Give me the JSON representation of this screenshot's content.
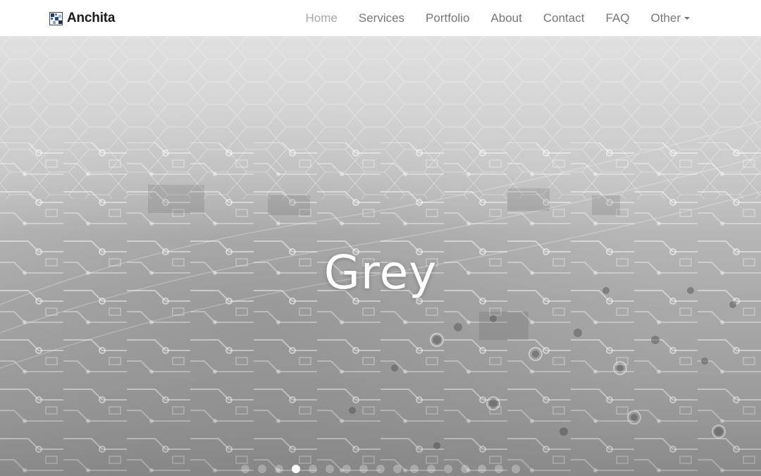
{
  "brand": {
    "name": "Anchita"
  },
  "nav": {
    "items": [
      {
        "label": "Home",
        "active": true
      },
      {
        "label": "Services"
      },
      {
        "label": "Portfolio"
      },
      {
        "label": "About"
      },
      {
        "label": "Contact"
      },
      {
        "label": "FAQ"
      },
      {
        "label": "Other",
        "dropdown": true
      }
    ]
  },
  "hero": {
    "title": "Grey",
    "slide_count": 17,
    "active_slide": 3
  }
}
